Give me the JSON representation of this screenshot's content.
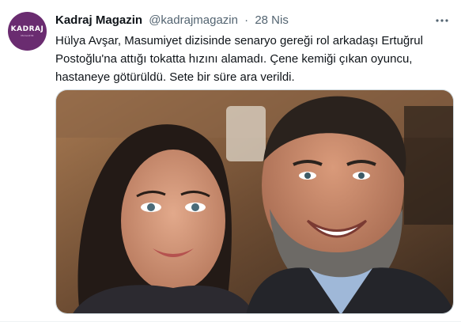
{
  "tweet": {
    "author": {
      "name": "Kadraj Magazin",
      "handle": "@kadrajmagazin",
      "avatar_text": "KADRAJ",
      "avatar_subtext": "MAGAZIN",
      "avatar_color": "#6a2c70"
    },
    "separator": "·",
    "date": "28 Nis",
    "text": "Hülya Avşar, Masumiyet dizisinde senaryo gereği rol arkadaşı Ertuğrul Postoğlu'na attığı tokatta hızını alamadı. Çene kemiği çıkan oyuncu, hastaneye götürüldü. Sete bir süre ara verildi.",
    "more_icon": "more-horizontal-icon"
  },
  "colors": {
    "text_primary": "#0f1419",
    "text_secondary": "#536471",
    "border": "#cfd9de"
  }
}
